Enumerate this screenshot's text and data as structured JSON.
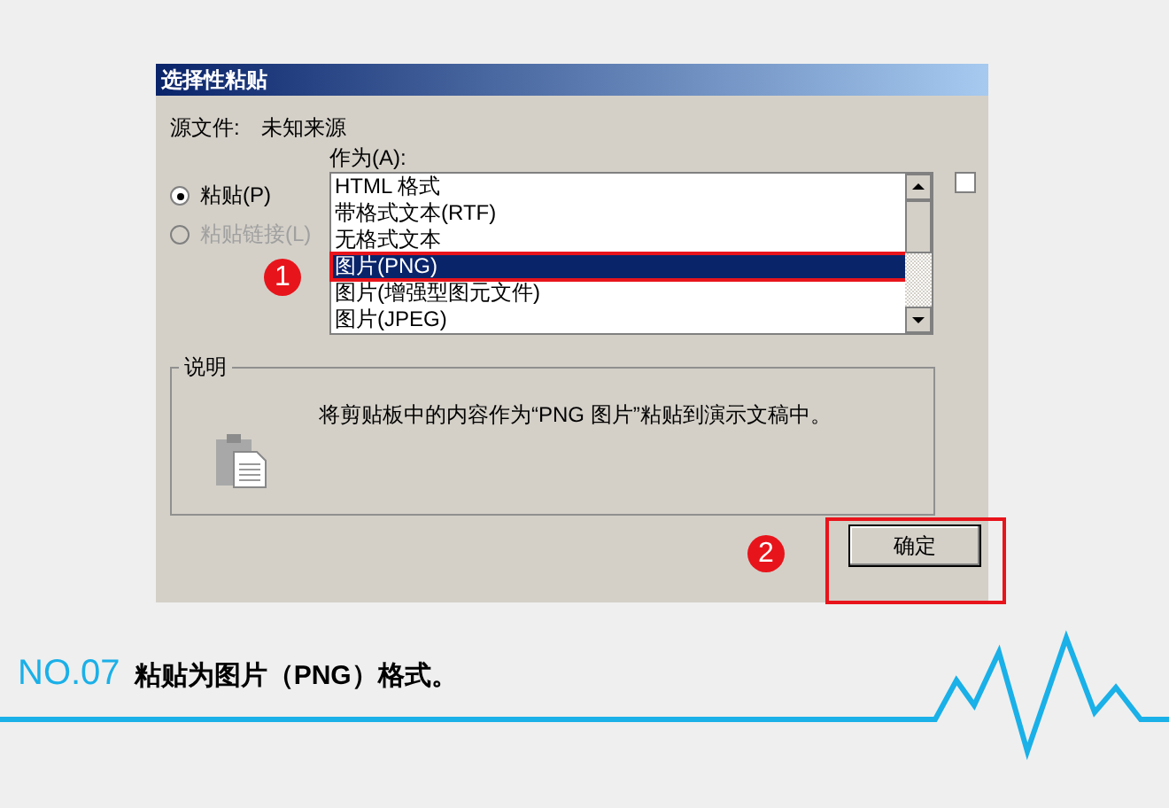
{
  "dialog": {
    "title": "选择性粘贴",
    "source_label": "源文件:",
    "source_value": "未知来源",
    "as_label": "作为(A):",
    "options": [
      {
        "label": "粘贴(P)",
        "selected": true,
        "disabled": false
      },
      {
        "label": "粘贴链接(L)",
        "selected": false,
        "disabled": true
      }
    ],
    "formats": [
      {
        "label": "HTML 格式",
        "selected": false
      },
      {
        "label": "带格式文本(RTF)",
        "selected": false
      },
      {
        "label": "无格式文本",
        "selected": false
      },
      {
        "label": "图片(PNG)",
        "selected": true
      },
      {
        "label": "图片(增强型图元文件)",
        "selected": false
      },
      {
        "label": "图片(JPEG)",
        "selected": false
      }
    ],
    "checkbox": {
      "checked": false
    },
    "description": {
      "title": "说明",
      "text": "将剪贴板中的内容作为“PNG 图片”粘贴到演示文稿中。"
    },
    "ok_button": "确定"
  },
  "callouts": [
    {
      "number": "1"
    },
    {
      "number": "2"
    }
  ],
  "caption": {
    "step": "NO.07",
    "text": "粘贴为图片（PNG）格式。"
  }
}
